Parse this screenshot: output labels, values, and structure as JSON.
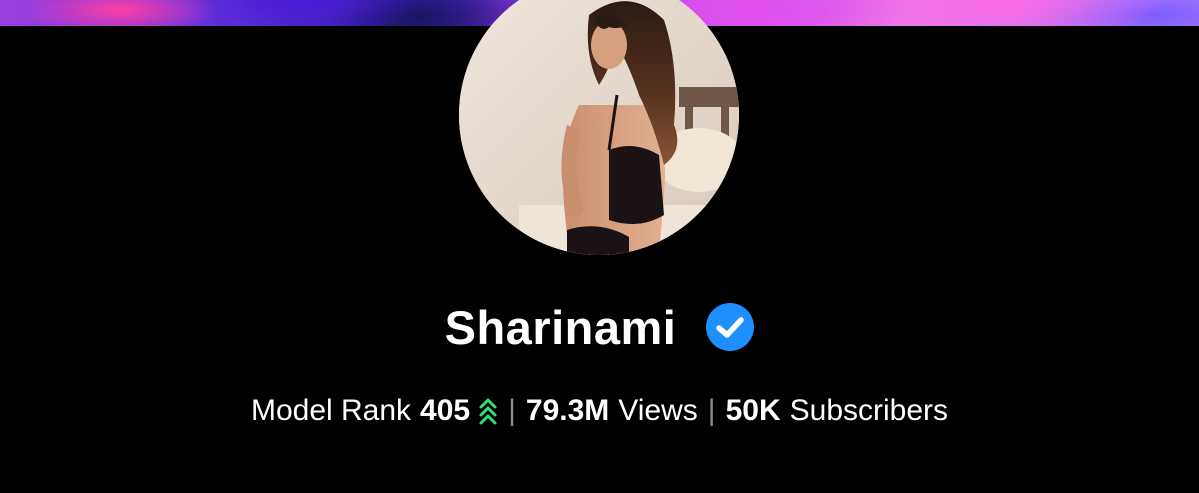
{
  "profile": {
    "name": "Sharinami",
    "verified_icon": "verified-badge-icon",
    "verified_color": "#1d8fff"
  },
  "stats": {
    "rank_label": "Model Rank",
    "rank_value": "405",
    "rank_trend_icon": "double-chevron-up-icon",
    "rank_trend_color": "#2ee06f",
    "views_value": "79.3M",
    "views_label": "Views",
    "subscribers_value": "50K",
    "subscribers_label": "Subscribers",
    "separator": "|"
  },
  "colors": {
    "background": "#000000",
    "text": "#ffffff",
    "separator": "#8a8a8a"
  }
}
